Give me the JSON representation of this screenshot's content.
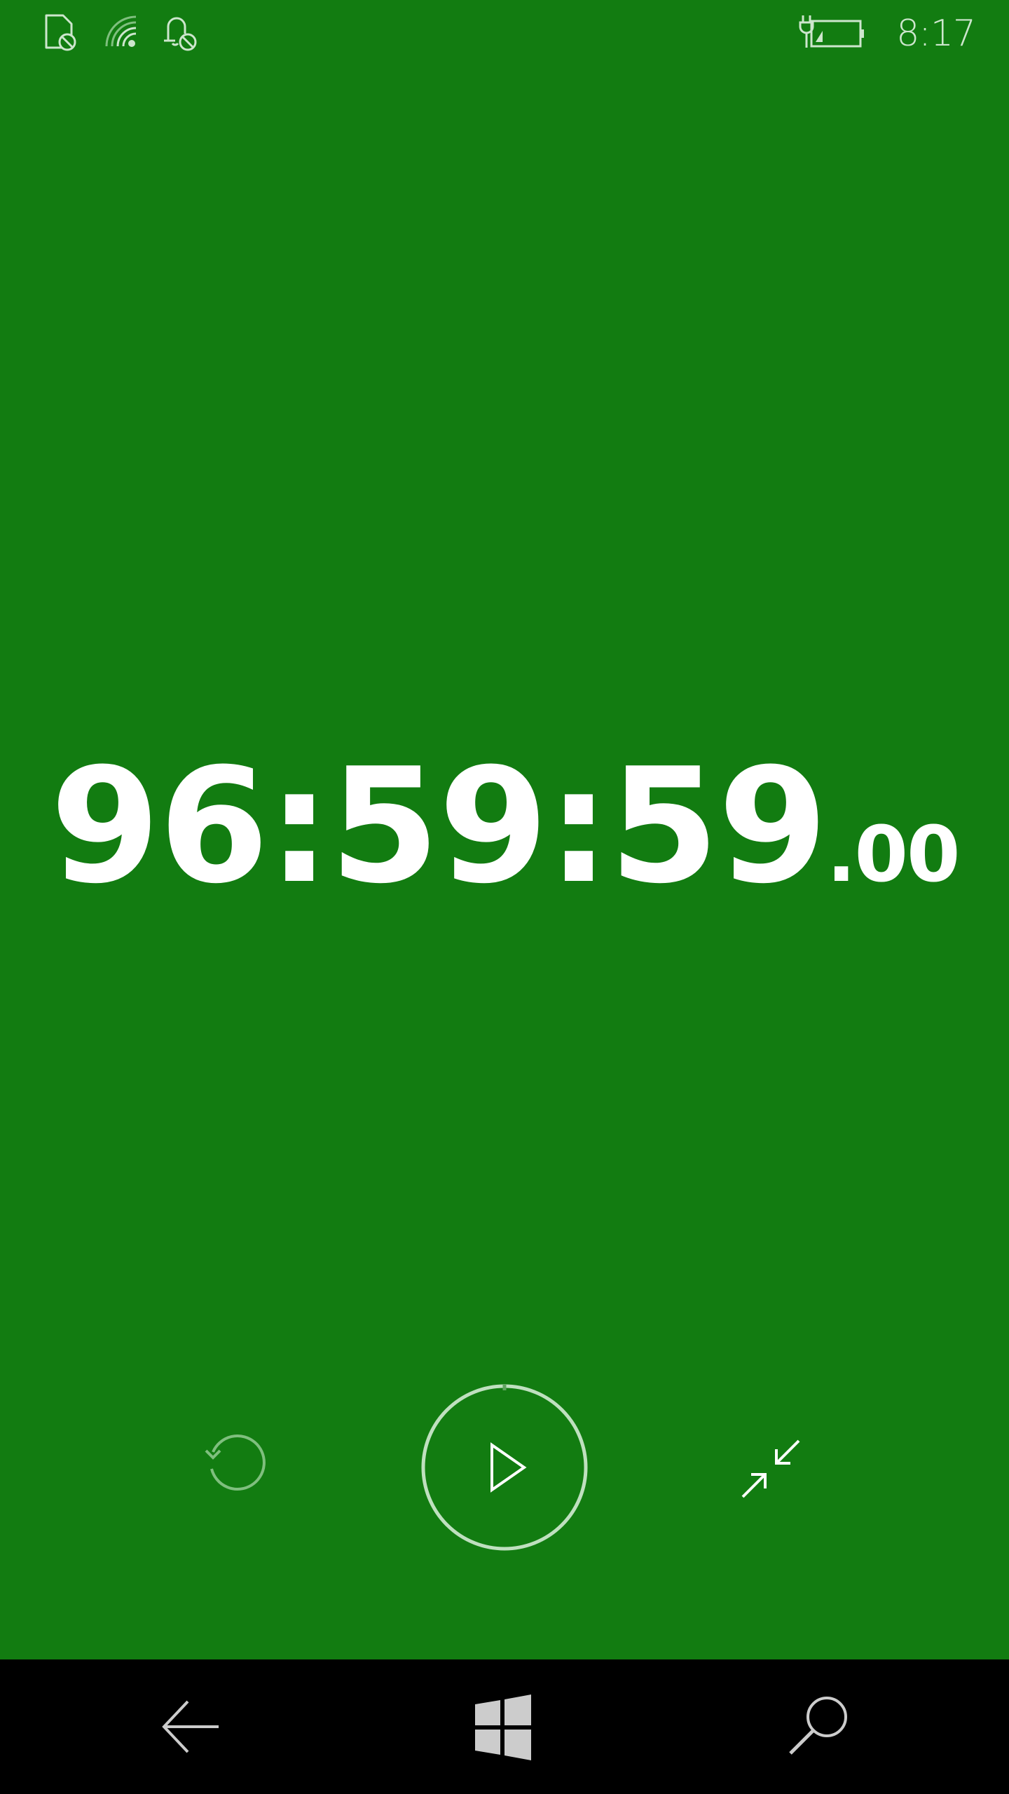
{
  "status_bar": {
    "time": "8:17",
    "icons": [
      "no-sim-icon",
      "wifi-icon",
      "no-notification-icon",
      "battery-charging-icon"
    ]
  },
  "timer": {
    "main": "96:59:59",
    "fraction": ".00"
  },
  "controls": {
    "reset": "reset-icon",
    "play": "play-icon",
    "compact": "compact-overlay-icon"
  },
  "nav": {
    "back": "back-arrow-icon",
    "home": "windows-logo-icon",
    "search": "search-icon"
  },
  "colors": {
    "accent_background": "#127c11",
    "foreground": "#ffffff",
    "dim_foreground": "#7fbf7e",
    "nav_background": "#000000",
    "nav_icon": "#cccccc"
  }
}
